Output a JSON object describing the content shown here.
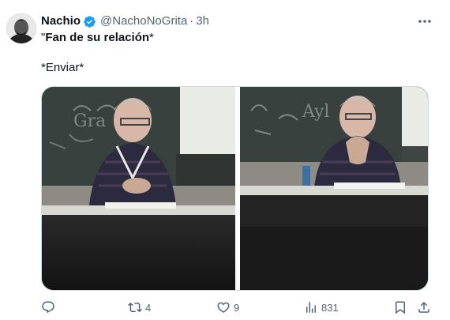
{
  "author": {
    "display_name": "Nachio",
    "handle": "@NachoNoGrita",
    "separator": "·",
    "time": "3h",
    "verified": true,
    "verified_color": "#1d9bf0"
  },
  "tweet": {
    "line1_prefix": "\"",
    "line1_bold": "Fan de su relación",
    "line1_suffix": "*",
    "line2": "*Enviar*"
  },
  "media": {
    "left_board_text": "Gra",
    "right_board_text": "Ayl"
  },
  "actions": {
    "reply_count": "",
    "retweet_count": "4",
    "like_count": "9",
    "views_count": "831"
  },
  "icons": {
    "more": "more-icon",
    "reply": "reply-icon",
    "retweet": "retweet-icon",
    "like": "heart-icon",
    "views": "views-icon",
    "bookmark": "bookmark-icon",
    "share": "share-icon"
  },
  "colors": {
    "text_primary": "#0f1419",
    "text_secondary": "#536471",
    "verified": "#1d9bf0"
  }
}
